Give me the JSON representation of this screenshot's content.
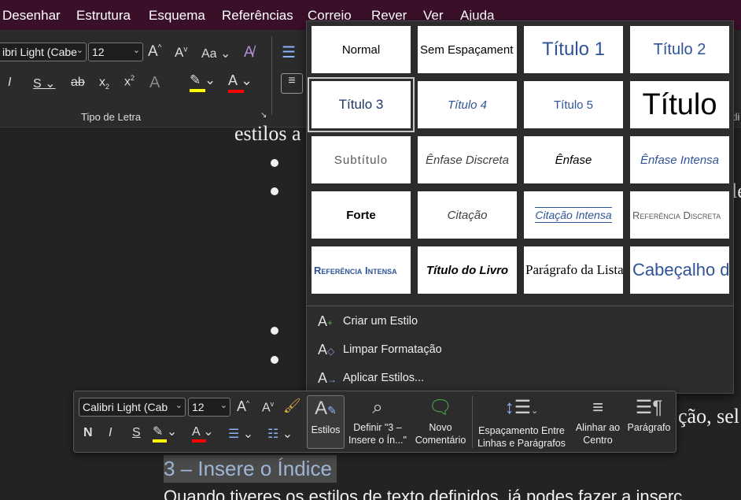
{
  "menu": [
    "Desenhar",
    "Estrutura",
    "Esquema",
    "Referências",
    "Correio",
    "Rever",
    "Ver",
    "Ajuda"
  ],
  "ribbon": {
    "font_name": "ibri Light (Cabe",
    "font_size": "12",
    "group_label": "Tipo de Letra",
    "aa_label": "Aa",
    "colors": {
      "highlight": "#ffff00",
      "font_color": "#ff0000"
    }
  },
  "document": {
    "line1": "estilos a",
    "right_fragment1": "le",
    "right_fragment2": "ção, sel",
    "heading": "3 – Insere o Índice",
    "body_last": "Quando tiveres os estilos de texto definidos, já podes fazer a inserç"
  },
  "styles_gallery": {
    "tiles": [
      "Normal",
      "Sem Espaçament",
      "Título 1",
      "Título 2",
      "Título 3",
      "Título 4",
      "Título 5",
      "Título",
      "Subtítulo",
      "Ênfase Discreta",
      "Ênfase",
      "Ênfase Intensa",
      "Forte",
      "Citação",
      "Citação Intensa",
      "Referência Discreta",
      "Referência Intensa",
      "Título do Livro",
      "Parágrafo da Lista",
      "Cabeçalho do Índice"
    ],
    "actions": [
      "Criar um Estilo",
      "Limpar Formatação",
      "Aplicar Estilos..."
    ]
  },
  "mini_toolbar": {
    "font_name": "Calibri Light (Cab",
    "font_size": "12",
    "buttons": {
      "estilos": "Estilos",
      "definir": "Definir \"3 –\nInsere o Ín...\"",
      "novo_comentario": "Novo\nComentário",
      "espacamento": "Espaçamento Entre\nLinhas e Parágrafos",
      "alinhar": "Alinhar ao\nCentro",
      "paragrafo": "Parágrafo"
    }
  }
}
